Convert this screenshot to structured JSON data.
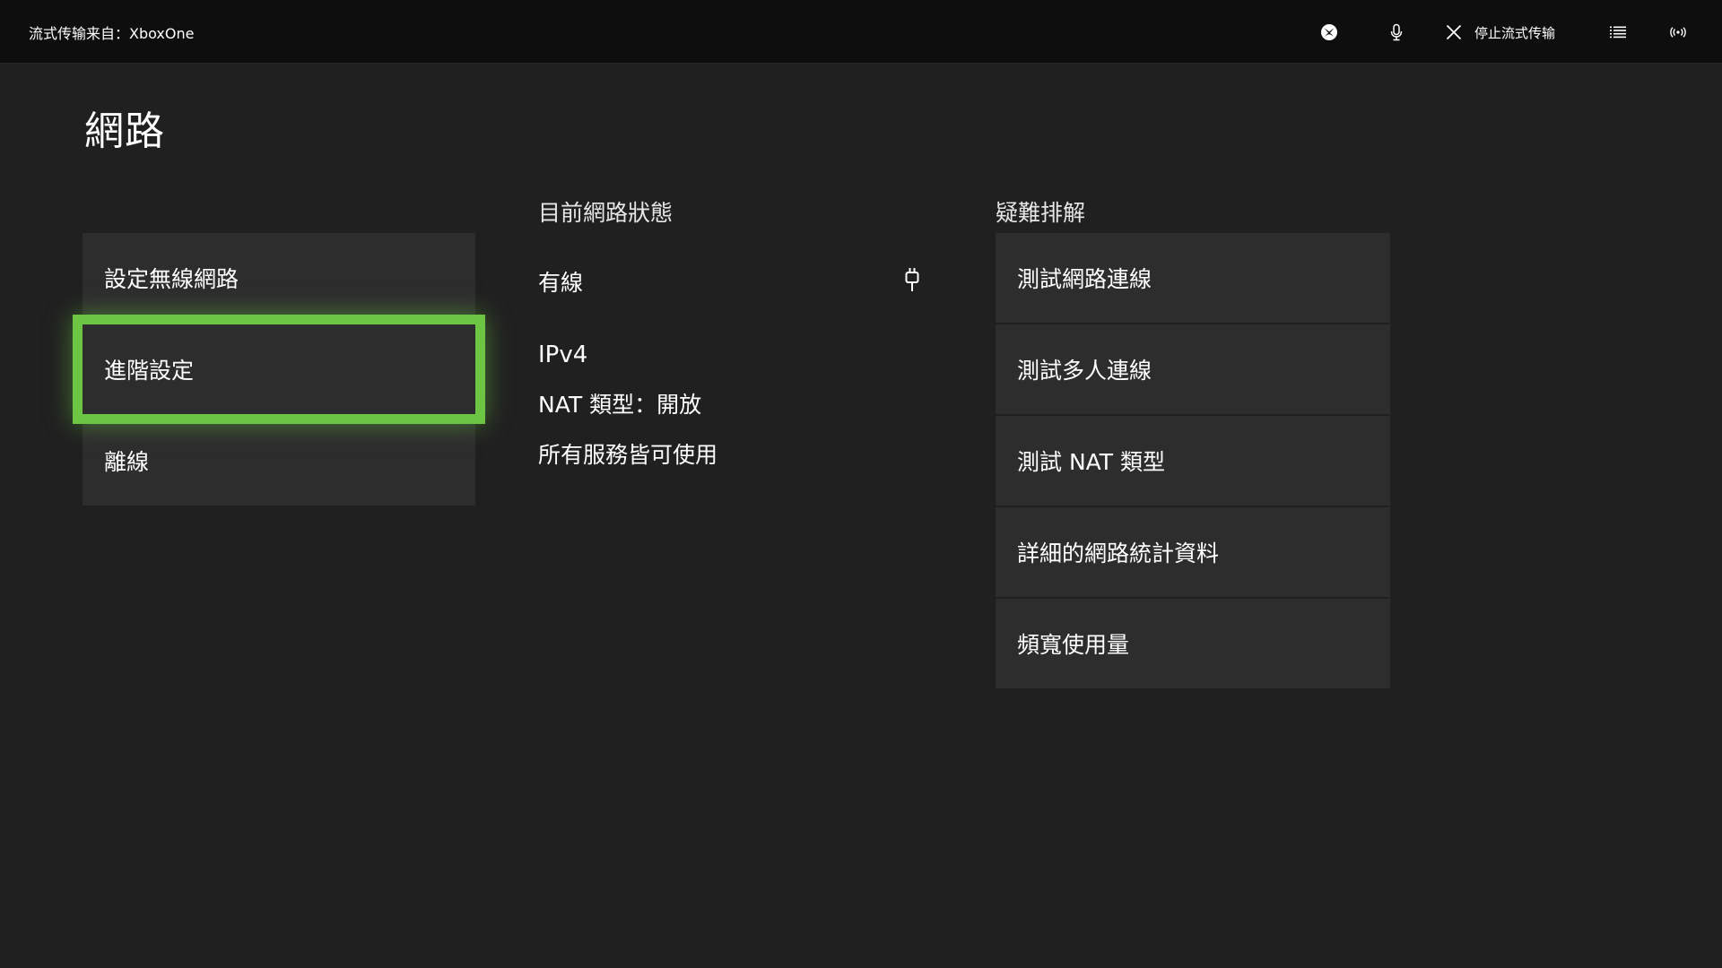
{
  "topbar": {
    "stream_title": "流式传输来自：XboxOne",
    "xbox_icon": "xbox-logo-icon",
    "mic_icon": "microphone-icon",
    "close_icon": "close-icon",
    "stop_label": "停止流式传输",
    "menu_icon": "list-icon",
    "signal_icon": "broadcast-icon"
  },
  "page": {
    "title": "網路"
  },
  "left_menu": {
    "items": [
      {
        "label": "設定無線網路"
      },
      {
        "label": "進階設定"
      },
      {
        "label": "離線"
      }
    ]
  },
  "status": {
    "heading": "目前網路狀態",
    "connection_label": "有線",
    "connection_icon": "ethernet-plug-icon",
    "lines": [
      "IPv4",
      "NAT 類型：開放",
      "所有服務皆可使用"
    ]
  },
  "troubleshoot": {
    "heading": "疑難排解",
    "items": [
      {
        "label": "測試網路連線"
      },
      {
        "label": "測試多人連線"
      },
      {
        "label": "測試 NAT 類型"
      },
      {
        "label": "詳細的網路統計資料"
      },
      {
        "label": "頻寬使用量"
      }
    ]
  },
  "colors": {
    "background": "#202020",
    "topbar": "#0e0e0e",
    "tile": "#2d2d2d",
    "focus": "#6cc644"
  }
}
